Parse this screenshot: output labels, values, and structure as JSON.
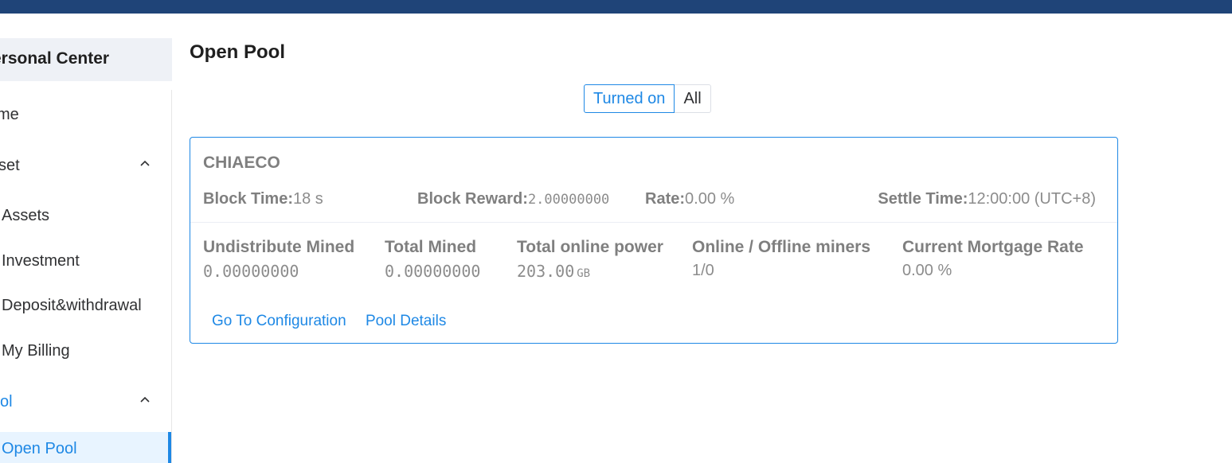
{
  "sidebar": {
    "header": "ersonal Center",
    "items": [
      {
        "label": "me"
      },
      {
        "label": "set"
      },
      {
        "label": "Assets"
      },
      {
        "label": "Investment"
      },
      {
        "label": "Deposit&withdrawal"
      },
      {
        "label": "My Billing"
      },
      {
        "label": "ol"
      },
      {
        "label": "Open Pool"
      }
    ]
  },
  "page": {
    "title": "Open Pool",
    "toggle": {
      "on": "Turned on",
      "all": "All",
      "selected": "Turned on"
    }
  },
  "pool": {
    "name": "CHIAECO",
    "block_time_label": "Block Time:",
    "block_time_value": "18 s",
    "block_reward_label": "Block Reward:",
    "block_reward_value": "2.00000000",
    "rate_label": "Rate:",
    "rate_value": "0.00 %",
    "settle_time_label": "Settle Time:",
    "settle_time_value": "12:00:00 (UTC+8)",
    "stats": [
      {
        "label": "Undistribute Mined",
        "value": "0.00000000"
      },
      {
        "label": "Total Mined",
        "value": "0.00000000"
      },
      {
        "label": "Total online power",
        "value": "203.00",
        "unit": "GB"
      },
      {
        "label": "Online / Offline miners",
        "value": "1/0"
      },
      {
        "label": "Current Mortgage Rate",
        "value": "0.00 %"
      }
    ],
    "links": {
      "config": "Go To Configuration",
      "details": "Pool Details"
    }
  },
  "colors": {
    "topbar": "#1f4478",
    "accent": "#1e88e5",
    "muted": "#7f7f7f"
  }
}
